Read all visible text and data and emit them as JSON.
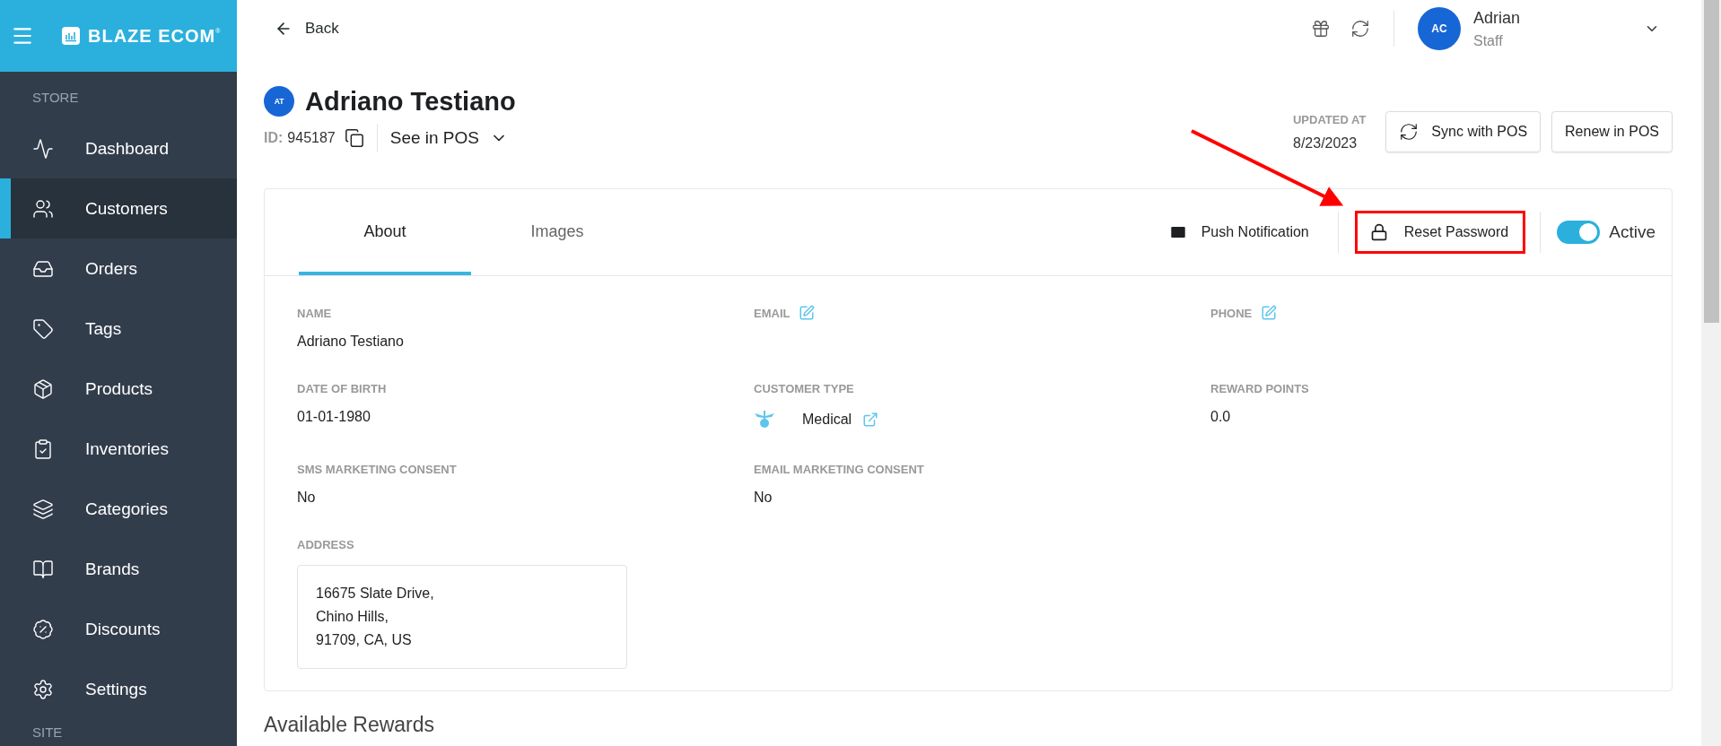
{
  "sidebar": {
    "brand": "BLAZE ECOM$^{®}$",
    "sections": [
      {
        "label": "STORE",
        "items": [
          {
            "label": "Dashboard",
            "selected": false
          },
          {
            "label": "Customers",
            "selected": true
          },
          {
            "label": "Orders",
            "selected": false
          },
          {
            "label": "Tags",
            "selected": false
          },
          {
            "label": "Products",
            "selected": false
          },
          {
            "label": "Inventories",
            "selected": false
          },
          {
            "label": "Categories",
            "selected": false
          },
          {
            "label": "Brands",
            "selected": false
          },
          {
            "label": "Discounts",
            "selected": false
          },
          {
            "label": "Settings",
            "selected": false
          }
        ]
      },
      {
        "label": "SITE"
      }
    ]
  },
  "header": {
    "back": "Back",
    "user": {
      "initials": "AC",
      "name": "Adrian",
      "role": "Staff"
    }
  },
  "customer": {
    "initials": "AT",
    "name": "Adriano Testiano",
    "id_label": "ID:",
    "id": "945187",
    "see_in_pos": "See in POS",
    "updated_label": "UPDATED AT",
    "updated": "8/23/2023",
    "buttons": [
      {
        "label": "Sync with POS",
        "kind": "sync"
      },
      {
        "label": "Renew in POS",
        "kind": "plain"
      }
    ]
  },
  "card": {
    "tabs": [
      {
        "label": "About",
        "selected": true
      },
      {
        "label": "Images",
        "selected": false
      }
    ],
    "push_notification": "Push Notification",
    "reset_password": {
      "label": "Reset Password",
      "highlighted": true
    },
    "toggle": {
      "label": "Active",
      "on": true
    },
    "field_rows": [
      [
        {
          "label": "NAME",
          "value": "Adriano Testiano",
          "kind": "text"
        },
        {
          "label": "EMAIL",
          "kind": "editable"
        },
        {
          "label": "PHONE",
          "kind": "editable"
        }
      ],
      [
        {
          "label": "DATE OF BIRTH",
          "value": "01-01-1980",
          "kind": "text"
        },
        {
          "label": "CUSTOMER TYPE",
          "value": "Medical",
          "kind": "customer_type"
        },
        {
          "label": "REWARD POINTS",
          "value": "0.0",
          "kind": "text"
        }
      ],
      [
        {
          "label": "SMS MARKETING CONSENT",
          "value": "No",
          "kind": "text"
        },
        {
          "label": "EMAIL MARKETING CONSENT",
          "value": "No",
          "kind": "text"
        }
      ],
      [
        {
          "label": "ADDRESS",
          "kind": "address",
          "lines": [
            "16675 Slate Drive,",
            "Chino Hills,",
            "91709, CA, US"
          ]
        }
      ]
    ]
  },
  "rewards_title": "Available Rewards"
}
